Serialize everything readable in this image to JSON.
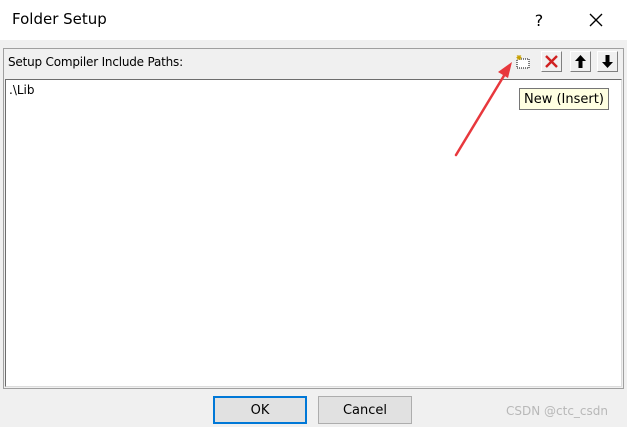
{
  "window": {
    "title": "Folder Setup",
    "help_glyph": "?",
    "close_icon": "close-icon"
  },
  "panel": {
    "label": "Setup Compiler Include Paths:",
    "toolbar": [
      {
        "name": "new-folder-button",
        "icon": "new-folder-icon"
      },
      {
        "name": "delete-button",
        "icon": "delete-x-icon"
      },
      {
        "name": "move-up-button",
        "icon": "arrow-up-icon"
      },
      {
        "name": "move-down-button",
        "icon": "arrow-down-icon"
      }
    ],
    "tooltip": "New (Insert)",
    "items": [
      ".\\Lib"
    ]
  },
  "buttons": {
    "ok": "OK",
    "cancel": "Cancel"
  },
  "watermark": "CSDN @ctc_csdn",
  "colors": {
    "annotation_arrow": "#e8383d",
    "default_button_border": "#0078d7",
    "tooltip_bg": "#ffffe1",
    "delete_icon": "#d02020"
  }
}
